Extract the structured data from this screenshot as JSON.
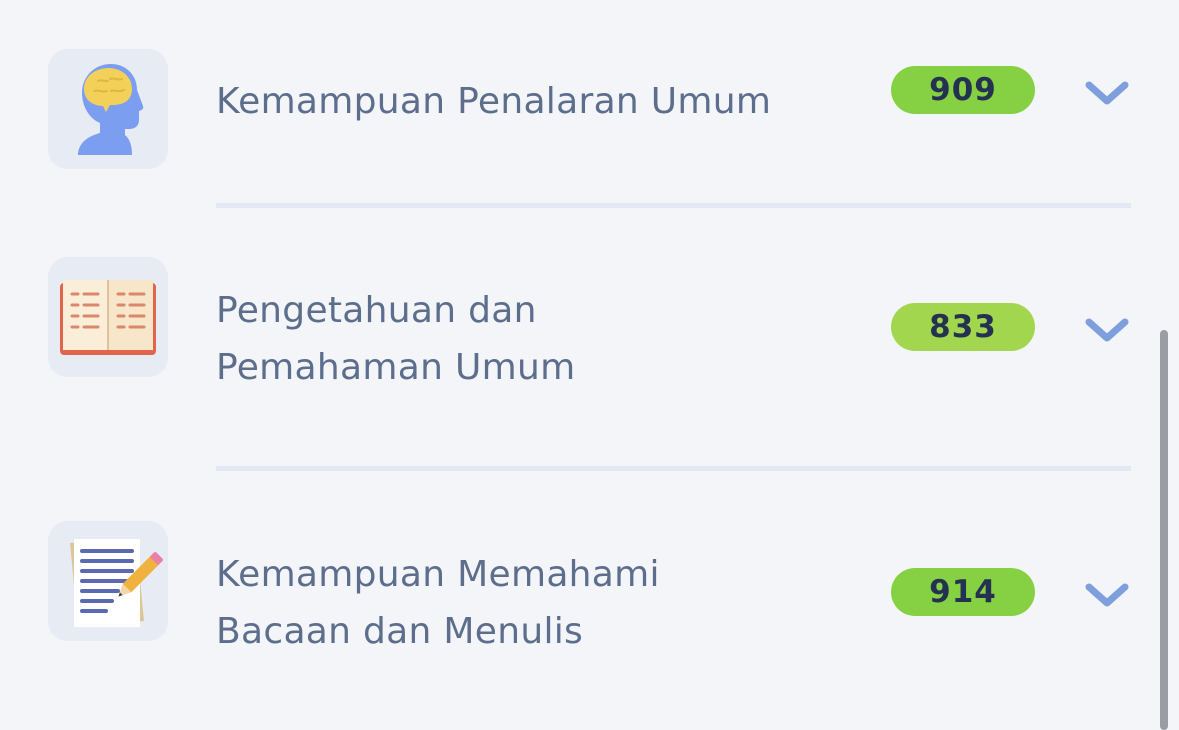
{
  "subtests": [
    {
      "title_lines": [
        "Kemampuan Penalaran Umum"
      ],
      "score": "909",
      "badge_color": "#86d043",
      "icon": "head-brain-icon"
    },
    {
      "title_lines": [
        "Pengetahuan dan",
        "Pemahaman Umum"
      ],
      "score": "833",
      "badge_color": "#a2d64e",
      "icon": "open-book-icon"
    },
    {
      "title_lines": [
        "Kemampuan Memahami",
        "Bacaan dan Menulis"
      ],
      "score": "914",
      "badge_color": "#86d043",
      "icon": "document-pencil-icon"
    }
  ],
  "expand_icon": "chevron-down-icon",
  "colors": {
    "background": "#f3f5f9",
    "icon_tile": "#e6ebf4",
    "title_text": "#5d6e8c",
    "score_text": "#243150",
    "chevron": "#7f9fdc",
    "divider": "#e3e9f3"
  }
}
